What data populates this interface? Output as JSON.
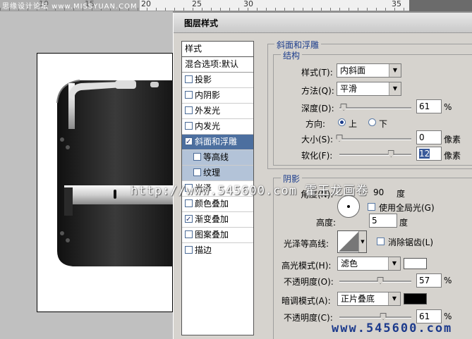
{
  "ruler": {
    "ticks": [
      "10",
      "15",
      "20",
      "25",
      "30",
      "35"
    ]
  },
  "watermark_top": "思缘设计论坛 www.MISSYUAN.COM",
  "watermark_mid": "http://www.545600.com 霍王龙画卷",
  "watermark_bottom": "www.545600.com",
  "dialog": {
    "title": "图层样式"
  },
  "styles_list": {
    "header": "样式",
    "blend_options": "混合选项:默认",
    "items": [
      {
        "label": "投影",
        "checked": false
      },
      {
        "label": "内阴影",
        "checked": false
      },
      {
        "label": "外发光",
        "checked": false
      },
      {
        "label": "内发光",
        "checked": false
      },
      {
        "label": "斜面和浮雕",
        "checked": true,
        "selected": true
      },
      {
        "label": "等高线",
        "checked": false,
        "sub": true
      },
      {
        "label": "纹理",
        "checked": false,
        "sub": true
      },
      {
        "label": "光泽",
        "checked": false
      },
      {
        "label": "颜色叠加",
        "checked": false
      },
      {
        "label": "渐变叠加",
        "checked": true
      },
      {
        "label": "图案叠加",
        "checked": false
      },
      {
        "label": "描边",
        "checked": false
      }
    ]
  },
  "bevel": {
    "section_title": "斜面和浮雕",
    "structure_title": "结构",
    "style_label": "样式(T):",
    "style_value": "内斜面",
    "technique_label": "方法(Q):",
    "technique_value": "平滑",
    "depth_label": "深度(D):",
    "depth_value": "61",
    "depth_unit": "%",
    "depth_slider": 0.06,
    "direction_label": "方向:",
    "direction_up": "上",
    "direction_down": "下",
    "size_label": "大小(S):",
    "size_value": "0",
    "size_unit": "像素",
    "size_slider": 0.0,
    "soften_label": "软化(F):",
    "soften_value": "12",
    "soften_unit": "像素",
    "soften_slider": 0.72
  },
  "shading": {
    "title": "阴影",
    "angle_label": "角度(N):",
    "angle_value": "90",
    "angle_unit": "度",
    "global_light_label": "使用全局光(G)",
    "altitude_label": "高度:",
    "altitude_value": "5",
    "altitude_unit": "度",
    "gloss_label": "光泽等高线:",
    "antialias_label": "消除锯齿(L)",
    "highlight_label": "高光模式(H):",
    "highlight_mode": "滤色",
    "highlight_color": "#ffffff",
    "hl_opacity_label": "不透明度(O):",
    "hl_opacity_value": "57",
    "hl_opacity_unit": "%",
    "hl_opacity_slider": 0.57,
    "shadow_label": "暗调模式(A):",
    "shadow_mode": "正片叠底",
    "shadow_color": "#000000",
    "sh_opacity_label": "不透明度(C):",
    "sh_opacity_value": "61",
    "sh_opacity_unit": "%",
    "sh_opacity_slider": 0.61
  }
}
